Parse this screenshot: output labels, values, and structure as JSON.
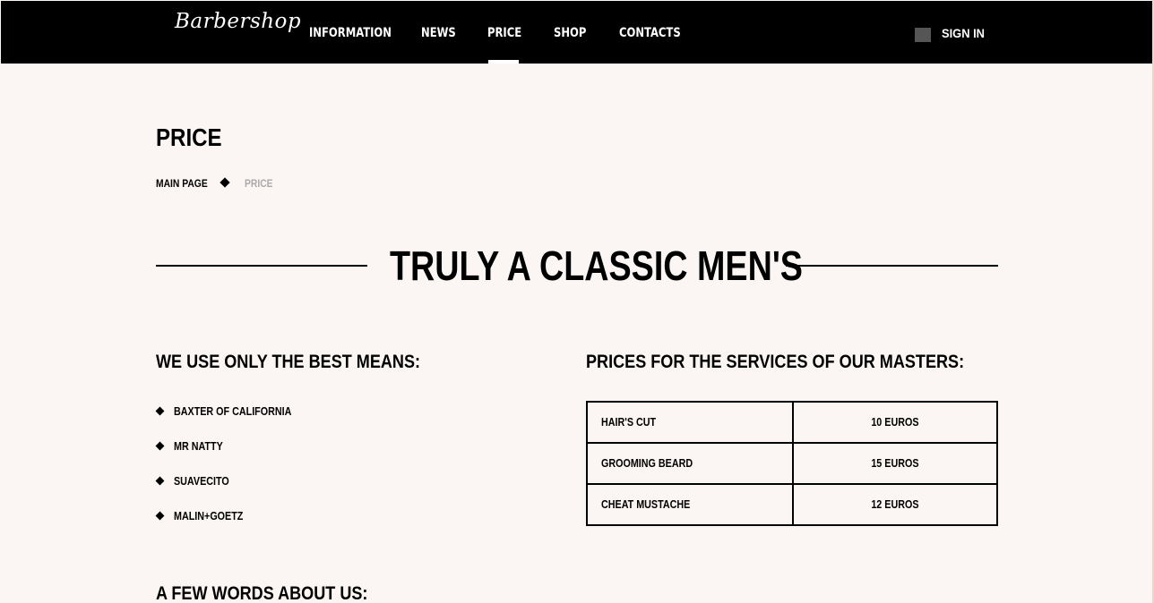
{
  "header": {
    "logo": "Barbershop",
    "nav": [
      {
        "label": "INFORMATION"
      },
      {
        "label": "NEWS"
      },
      {
        "label": "PRICE",
        "active": true
      },
      {
        "label": "SHOP"
      },
      {
        "label": "CONTACTS"
      }
    ],
    "signin_label": "SIGN IN",
    "signin_icon": "login-icon"
  },
  "page": {
    "title": "PRICE",
    "breadcrumb": {
      "home": "MAIN PAGE",
      "current": "PRICE"
    }
  },
  "hero": {
    "title": "TRULY A CLASSIC MEN'S"
  },
  "means": {
    "heading": "WE USE ONLY THE BEST MEANS:",
    "items": [
      "BAXTER OF CALIFORNIA",
      "MR NATTY",
      "SUAVECITO",
      "MALIN+GOETZ"
    ]
  },
  "prices": {
    "heading": "PRICES FOR THE SERVICES OF OUR MASTERS:",
    "rows": [
      {
        "service": "HAIR'S CUT",
        "price": "10 EUROS"
      },
      {
        "service": "GROOMING BEARD",
        "price": "15 EUROS"
      },
      {
        "service": "CHEAT MUSTACHE",
        "price": "12 EUROS"
      }
    ]
  },
  "about": {
    "heading": "A FEW WORDS ABOUT US:"
  },
  "colors": {
    "header_bg": "#000000",
    "page_bg": "#fbf6f3",
    "muted": "#aaaaaa"
  }
}
